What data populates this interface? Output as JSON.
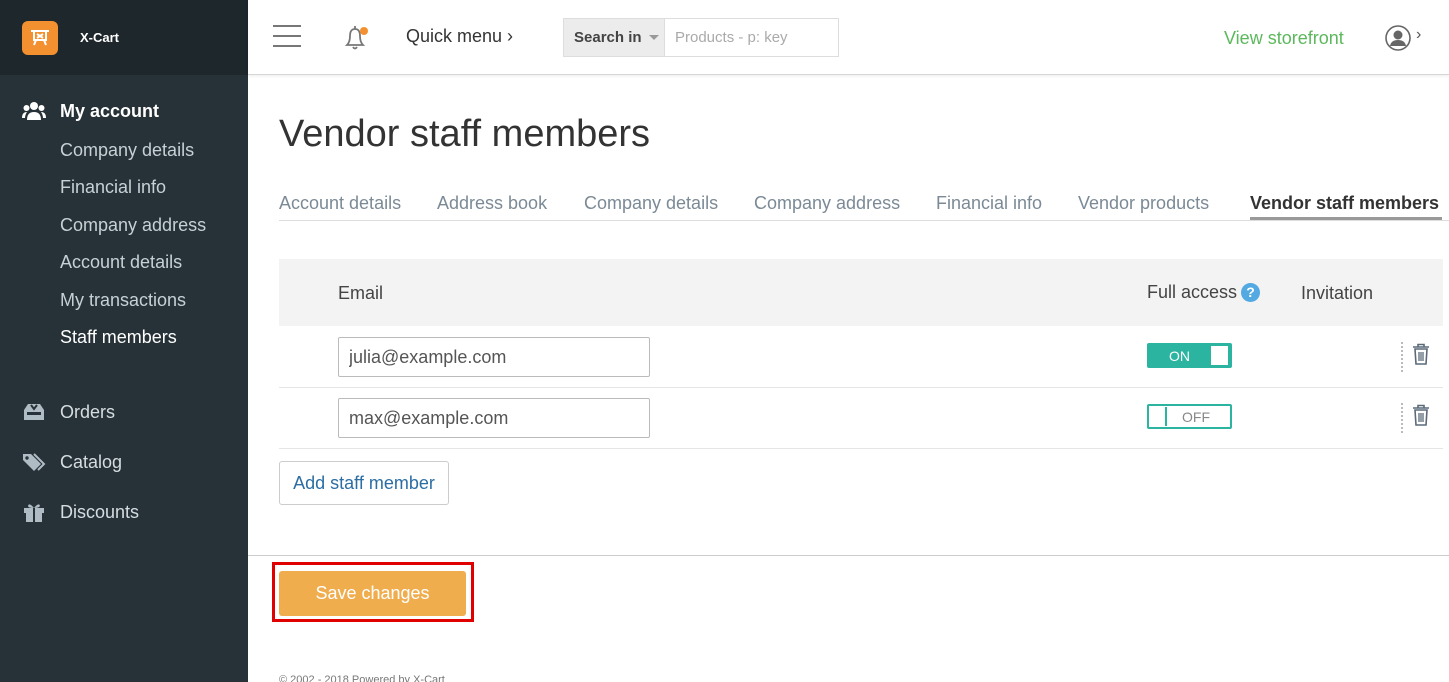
{
  "app": {
    "brand": "X-Cart"
  },
  "sidebar": {
    "sections": [
      {
        "label": "My account",
        "icon": "users-icon",
        "active": true
      },
      {
        "label": "Orders",
        "icon": "inbox-icon"
      },
      {
        "label": "Catalog",
        "icon": "tags-icon"
      },
      {
        "label": "Discounts",
        "icon": "gift-icon"
      }
    ],
    "account_items": [
      "Company details",
      "Financial info",
      "Company address",
      "Account details",
      "My transactions",
      "Staff members"
    ],
    "current_item": "Staff members"
  },
  "header": {
    "quick_menu": "Quick menu ›",
    "search_scope": "Search in",
    "search_placeholder": "Products - p: key",
    "view_storefront": "View storefront",
    "notification_dot_color": "#f39130"
  },
  "page": {
    "title": "Vendor staff members",
    "tabs": [
      "Account details",
      "Address book",
      "Company details",
      "Company address",
      "Financial info",
      "Vendor products",
      "Vendor staff members"
    ],
    "active_tab": "Vendor staff members"
  },
  "table": {
    "columns": {
      "email": "Email",
      "full_access": "Full access",
      "full_access_help": "?",
      "invitation": "Invitation"
    },
    "rows": [
      {
        "email": "julia@example.com",
        "full_access": "ON"
      },
      {
        "email": "max@example.com",
        "full_access": "OFF"
      }
    ]
  },
  "actions": {
    "add_staff": "Add staff member",
    "save": "Save changes"
  },
  "footer": {
    "copyright": "© 2002 - 2018 Powered by X-Cart"
  },
  "colors": {
    "accent_green": "#5cb85c",
    "toggle": "#2bb5a0",
    "save": "#f0ad4e",
    "highlight": "#e00000"
  }
}
